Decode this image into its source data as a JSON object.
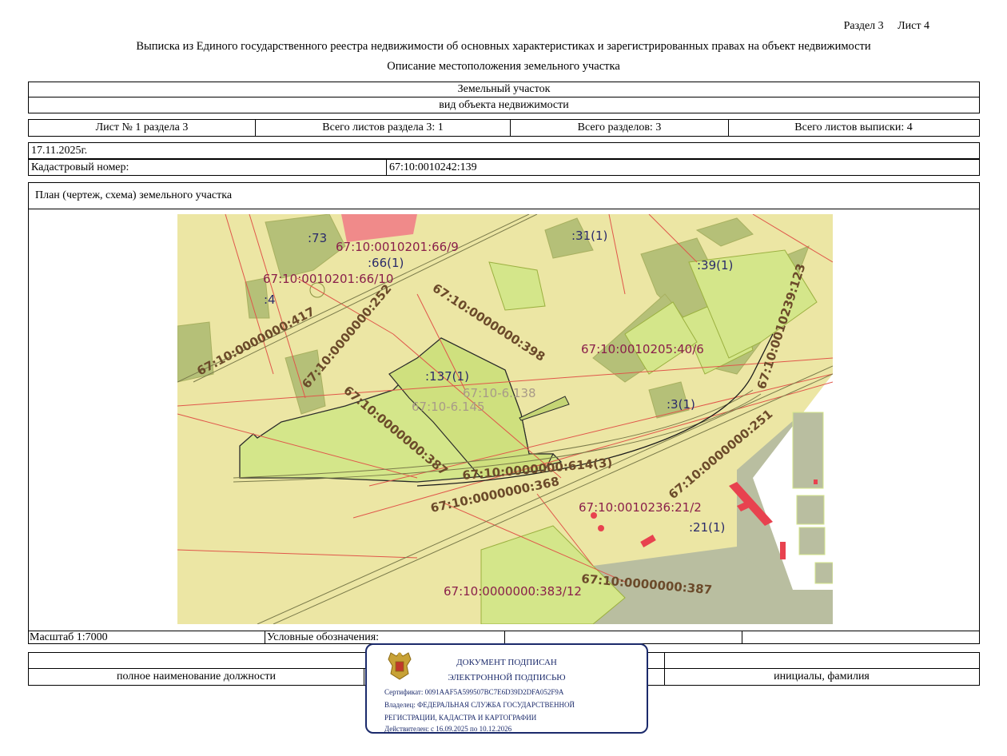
{
  "header": {
    "section": "Раздел 3",
    "sheet": "Лист 4",
    "title": "Выписка из Единого государственного реестра недвижимости об основных характеристиках и зарегистрированных правах на объект недвижимости",
    "subtitle": "Описание местоположения земельного участка"
  },
  "object": {
    "name": "Земельный участок",
    "kind_label": "вид объекта недвижимости"
  },
  "sheets": {
    "sheet_no": "Лист № 1 раздела 3",
    "total_sheets_section": "Всего листов раздела 3: 1",
    "total_sections": "Всего разделов: 3",
    "total_sheets_extract": "Всего листов выписки: 4"
  },
  "date": "17.11.2025г.",
  "cadastral": {
    "label": "Кадастровый номер:",
    "value": "67:10:0010242:139"
  },
  "plan": {
    "title": "План (чертеж, схема) земельного участка",
    "labels": {
      "l1": ":73",
      "l2": "67:10:0010201:66/9",
      "l3": ":66(1)",
      "l4": "67:10:0010201:66/10",
      "l5": ":4",
      "l6": ":31(1)",
      "l7": ":39(1)",
      "l8": "67:10:0000000:417",
      "l9": "67:10:0000000:252",
      "l10": "67:10:0000000:398",
      "l11": "67:10:0010205:40/6",
      "l12": "67:10:0010239:123",
      "l13": ":137(1)",
      "l14": "67:10-6.138",
      "l15": "67:10-6.145",
      "l16": ":3(1)",
      "l17": "67:10:0000000:387",
      "l18": "67:10:0000000:614(3)",
      "l19": "67:10:0000000:251",
      "l20": "67:10:0000000:368",
      "l21": "67:10:0010236:21/2",
      "l22": ":21(1)",
      "l23": "67:10:0000000:387",
      "l24": "67:10:0000000:383/12"
    }
  },
  "footer": {
    "scale": "Масштаб 1:7000",
    "legend": "Условные обозначения:",
    "position_label": "полное наименование должности",
    "initials_label": "инициалы, фамилия"
  },
  "signature": {
    "line1": "ДОКУМЕНТ ПОДПИСАН",
    "line2": "ЭЛЕКТРОННОЙ ПОДПИСЬЮ",
    "certificate": "Сертификат: 0091AAF5A599507BC7E6D39D2DFA052F9A",
    "owner1": "Владелец: ФЕДЕРАЛЬНАЯ СЛУЖБА ГОСУДАРСТВЕННОЙ",
    "owner2": "РЕГИСТРАЦИИ, КАДАСТРА И КАРТОГРАФИИ",
    "valid": "Действителен: с 16.09.2025 по 10.12.2026"
  },
  "colors": {
    "map_bg": "#ece6a4",
    "parcel_green": "#d4e68a",
    "dark_green": "#b5c078",
    "gray_zone": "#b9bea0",
    "red_line": "#e0564a",
    "red_building": "#e8424f",
    "label_maroon": "#8a1f4a",
    "label_brown": "#6b4a2a",
    "label_navy": "#2a2a6a",
    "stamp_blue": "#1b2a6b"
  }
}
